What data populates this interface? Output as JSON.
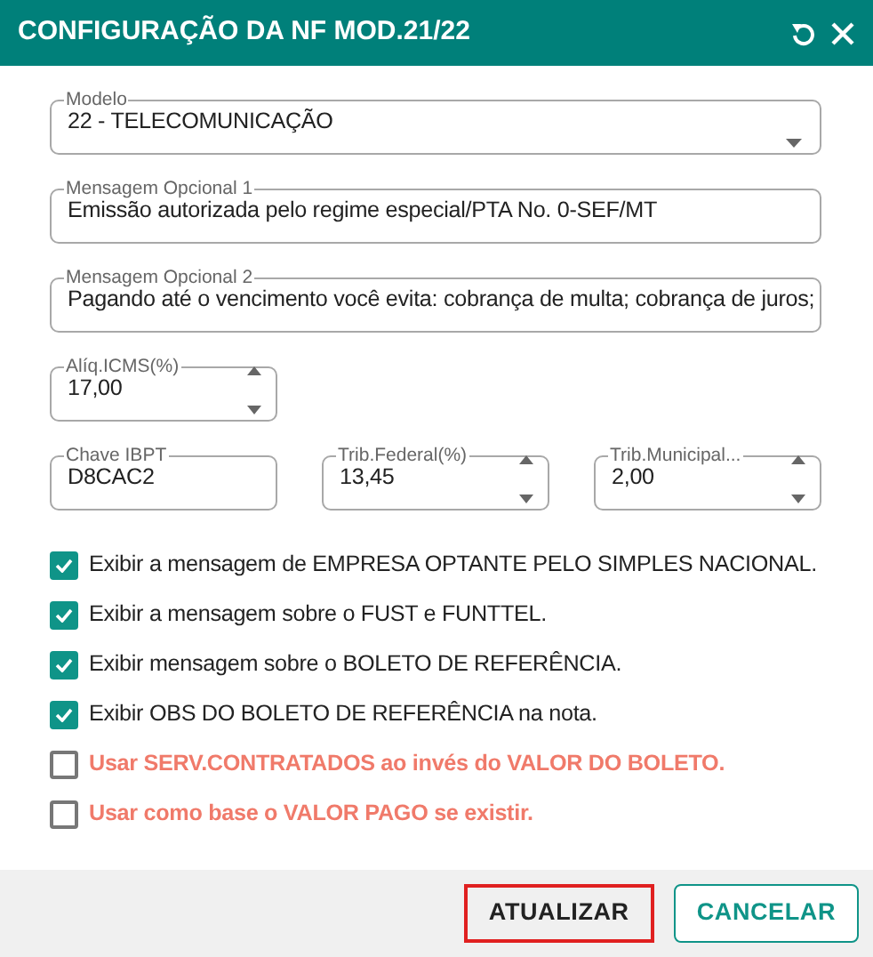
{
  "window": {
    "title": "CONFIGURAÇÃO DA NF MOD.21/22"
  },
  "fields": [
    {
      "kind": "select",
      "label": "Modelo",
      "value": "22 - TELECOMUNICAÇÃO"
    },
    {
      "kind": "text",
      "label": "Mensagem Opcional 1",
      "value": "Emissão autorizada pelo regime especial/PTA No. 0-SEF/MT"
    },
    {
      "kind": "text",
      "label": "Mensagem Opcional 2",
      "value": "Pagando até o vencimento você evita: cobrança de multa; cobrança de juros;"
    },
    {
      "kind": "number",
      "label": "Alíq.ICMS(%)",
      "value": "17,00"
    }
  ],
  "tax_fields": [
    {
      "kind": "text",
      "label": "Chave IBPT",
      "value": "D8CAC2"
    },
    {
      "kind": "number",
      "label": "Trib.Federal(%)",
      "value": "13,45"
    },
    {
      "kind": "number",
      "label": "Trib.Municipal...",
      "value": "2,00"
    }
  ],
  "options": [
    {
      "kind": "normal",
      "label": "Exibir a mensagem de EMPRESA OPTANTE PELO SIMPLES NACIONAL.",
      "checked": true
    },
    {
      "kind": "normal",
      "label": "Exibir a mensagem sobre o FUST e FUNTTEL.",
      "checked": true
    },
    {
      "kind": "normal",
      "label": "Exibir mensagem sobre o BOLETO DE REFERÊNCIA.",
      "checked": true
    },
    {
      "kind": "normal",
      "label": "Exibir OBS DO BOLETO DE REFERÊNCIA na nota.",
      "checked": true
    },
    {
      "kind": "warning",
      "label": "Usar SERV.CONTRATADOS ao invés do VALOR DO BOLETO.",
      "checked": false
    },
    {
      "kind": "warning",
      "label": "Usar como base o VALOR PAGO se existir.",
      "checked": false
    }
  ],
  "buttons": [
    {
      "kind": "primary",
      "label": "ATUALIZAR",
      "highlighted": true
    },
    {
      "kind": "outline",
      "label": "CANCELAR",
      "highlighted": false
    }
  ]
}
